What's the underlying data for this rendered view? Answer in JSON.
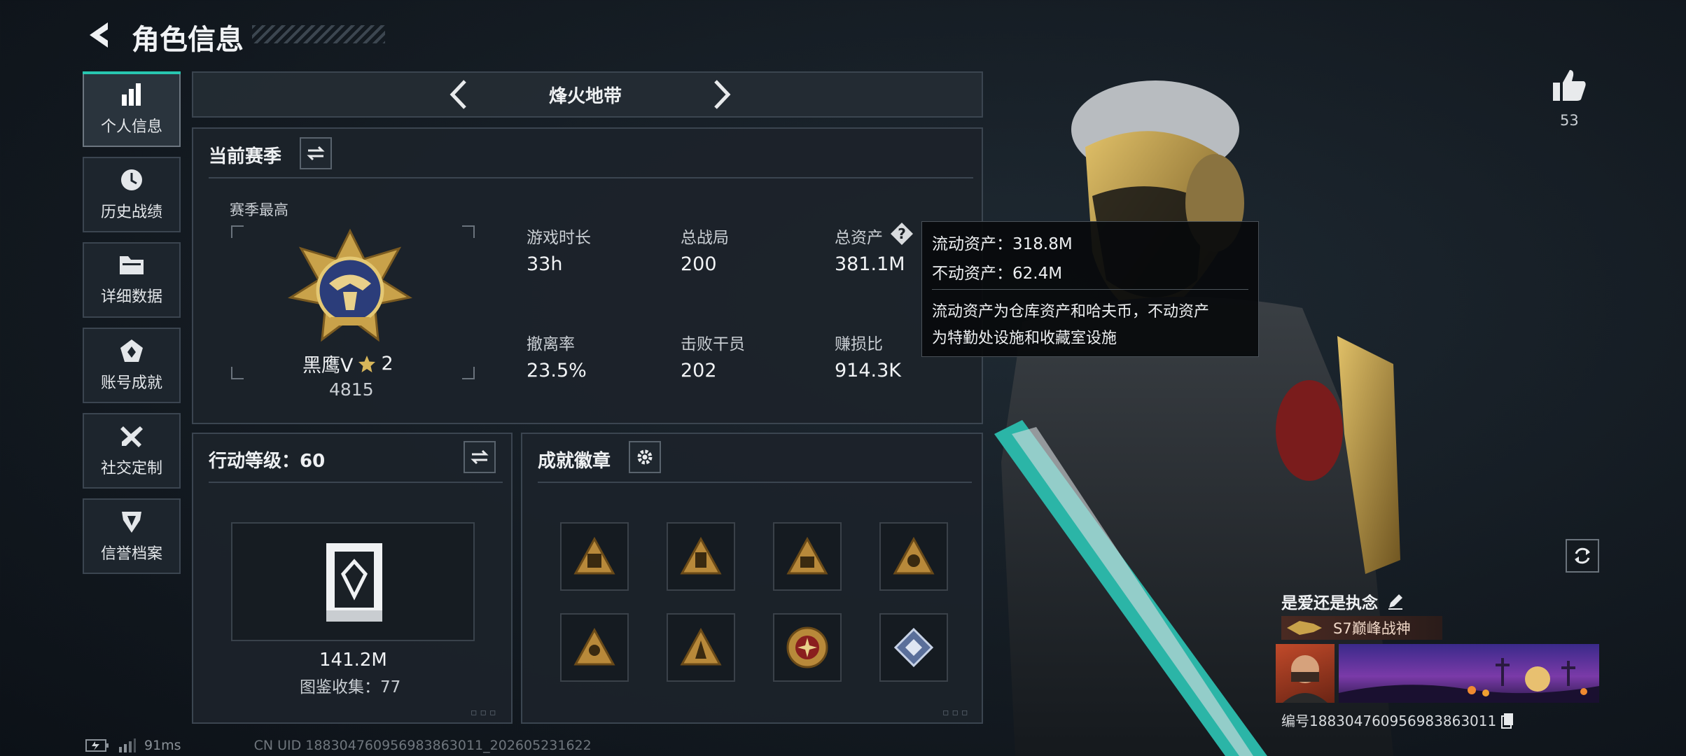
{
  "header": {
    "title": "角色信息"
  },
  "sidebar": {
    "items": [
      {
        "label": "个人信息",
        "icon": "bar-chart-icon",
        "active": true
      },
      {
        "label": "历史战绩",
        "icon": "clock-icon"
      },
      {
        "label": "详细数据",
        "icon": "folder-icon"
      },
      {
        "label": "账号成就",
        "icon": "achievement-icon"
      },
      {
        "label": "社交定制",
        "icon": "wrench-icon"
      },
      {
        "label": "信誉档案",
        "icon": "shield-icon"
      }
    ]
  },
  "mode_selector": {
    "label": "烽火地带"
  },
  "season": {
    "header": "当前赛季",
    "best_label": "赛季最高",
    "rank_name": "黑鹰Ⅴ",
    "rank_stars": "2",
    "rank_score": "4815",
    "stats": [
      {
        "label": "游戏时长",
        "value": "33h"
      },
      {
        "label": "总战局",
        "value": "200"
      },
      {
        "label": "总资产",
        "value": "381.1M"
      },
      {
        "label": "撤离率",
        "value": "23.5%"
      },
      {
        "label": "击败干员",
        "value": "202"
      },
      {
        "label": "赚损比",
        "value": "914.3K"
      }
    ]
  },
  "tooltip": {
    "liquid": "流动资产：318.8M",
    "fixed": "不动资产：62.4M",
    "desc_line1": "流动资产为仓库资产和哈夫币，不动资产",
    "desc_line2": "为特勤处设施和收藏室设施"
  },
  "action_level": {
    "header": "行动等级：60",
    "value": "141.2M",
    "collection": "图鉴收集：77"
  },
  "achievements": {
    "header": "成就徽章"
  },
  "like": {
    "count": "53"
  },
  "profile": {
    "name": "是爱还是执念",
    "title": "S7巅峰战神",
    "id_text": "编号18830476095698386301​1"
  },
  "status_bar": {
    "ping": "91ms",
    "uid": "CN UID 18830476095698386301​1_202605231622"
  },
  "colors": {
    "accent": "#28c6b0",
    "gold": "#c9a24a",
    "panel": "#1c232a"
  }
}
